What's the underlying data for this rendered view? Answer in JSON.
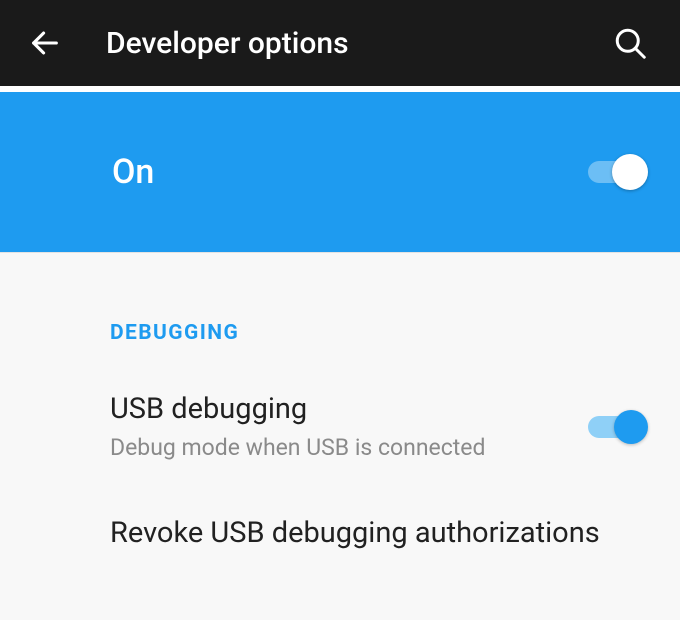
{
  "header": {
    "title": "Developer options"
  },
  "master_switch": {
    "label": "On",
    "state": true
  },
  "section": {
    "debugging_header": "DEBUGGING"
  },
  "items": {
    "usb_debugging": {
      "title": "USB debugging",
      "subtitle": "Debug mode when USB is connected",
      "state": true
    },
    "revoke": {
      "title": "Revoke USB debugging authorizations"
    }
  }
}
